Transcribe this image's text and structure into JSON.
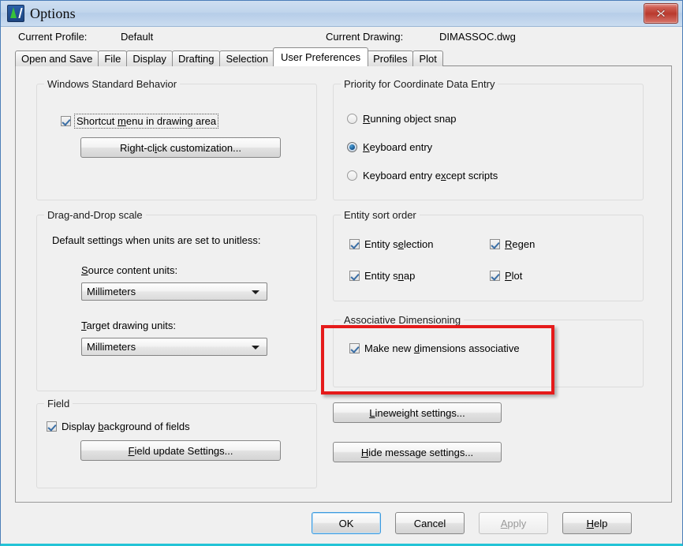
{
  "window": {
    "title": "Options",
    "app_icon": "autocad-icon",
    "close_label": "close-icon"
  },
  "header": {
    "profile_label": "Current Profile:",
    "profile_value": "Default",
    "drawing_label": "Current Drawing:",
    "drawing_value": "DIMASSOC.dwg"
  },
  "tabs": [
    {
      "label": "Open and Save",
      "active": false
    },
    {
      "label": "File",
      "active": false
    },
    {
      "label": "Display",
      "active": false
    },
    {
      "label": "Drafting",
      "active": false
    },
    {
      "label": "Selection",
      "active": false
    },
    {
      "label": "User Preferences",
      "active": true
    },
    {
      "label": "Profiles",
      "active": false
    },
    {
      "label": "Plot",
      "active": false
    }
  ],
  "windows_standard_behavior": {
    "title": "Windows Standard Behavior",
    "shortcut_menu": {
      "label_before": "Shortcut ",
      "label_accel": "m",
      "label_after": "enu in drawing area",
      "checked": true,
      "focused": true
    },
    "right_click_button": {
      "label_before": "Right-cl",
      "label_accel": "i",
      "label_after": "ck customization..."
    }
  },
  "priority_coordinate": {
    "title": "Priority for Coordinate Data Entry",
    "options": [
      {
        "label_accel": "R",
        "label_after": "unning object snap",
        "selected": false
      },
      {
        "label_accel": "K",
        "label_after": "eyboard entry",
        "selected": true
      },
      {
        "label_before": "Keyboard entry e",
        "label_accel": "x",
        "label_after": "cept scripts",
        "selected": false
      }
    ]
  },
  "drag_drop_scale": {
    "title": "Drag-and-Drop scale",
    "description": "Default settings when units are set to unitless:",
    "source_label_accel": "S",
    "source_label_after": "ource content units:",
    "source_value": "Millimeters",
    "target_label_accel": "T",
    "target_label_after": "arget drawing units:",
    "target_value": "Millimeters"
  },
  "entity_sort_order": {
    "title": "Entity sort order",
    "items": [
      {
        "before": "Entity s",
        "accel": "e",
        "after": "lection",
        "checked": true
      },
      {
        "before": "",
        "accel": "R",
        "after": "egen",
        "checked": true
      },
      {
        "before": "Entity s",
        "accel": "n",
        "after": "ap",
        "checked": true
      },
      {
        "before": "",
        "accel": "P",
        "after": "lot",
        "checked": true
      }
    ]
  },
  "associative_dimensioning": {
    "title": "Associative Dimensioning",
    "checkbox": {
      "before": "Make new ",
      "accel": "d",
      "after": "imensions associative",
      "checked": true
    },
    "highlight_color": "#e51b1b"
  },
  "field": {
    "title": "Field",
    "checkbox": {
      "before": "Display ",
      "accel": "b",
      "after": "ackground of fields",
      "checked": true
    },
    "update_button": {
      "accel": "F",
      "after": "ield update Settings..."
    }
  },
  "side_buttons": {
    "lineweight": {
      "accel": "L",
      "after": "ineweight settings..."
    },
    "hide_message": {
      "accel": "H",
      "after": "ide message settings..."
    }
  },
  "footer_buttons": [
    {
      "label": "OK",
      "accel": "",
      "state": "default"
    },
    {
      "label": "Cancel",
      "accel": "",
      "state": "normal"
    },
    {
      "label": "Apply",
      "accel": "A",
      "after": "pply",
      "state": "disabled"
    },
    {
      "label": "Help",
      "accel": "H",
      "after": "elp",
      "state": "normal"
    }
  ]
}
